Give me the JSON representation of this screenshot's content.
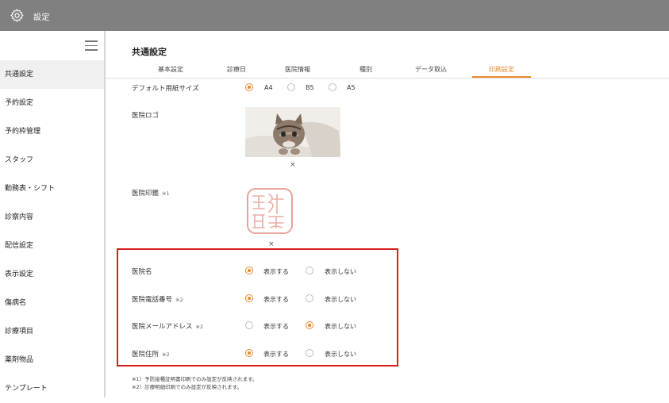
{
  "header": {
    "title": "設定",
    "icon": "gear-icon"
  },
  "sidebar": {
    "items": [
      {
        "label": "共通設定",
        "active": true
      },
      {
        "label": "予約設定"
      },
      {
        "label": "予約枠管理"
      },
      {
        "label": "スタッフ"
      },
      {
        "label": "勤務表・シフト"
      },
      {
        "label": "診察内容"
      },
      {
        "label": "配信設定"
      },
      {
        "label": "表示設定"
      },
      {
        "label": "傷病名"
      },
      {
        "label": "診療項目"
      },
      {
        "label": "薬剤物品"
      },
      {
        "label": "テンプレート"
      }
    ]
  },
  "main": {
    "title": "共通設定",
    "tabs": [
      {
        "label": "基本設定"
      },
      {
        "label": "診療日"
      },
      {
        "label": "医院情報"
      },
      {
        "label": "種別"
      },
      {
        "label": "データ取込"
      },
      {
        "label": "印刷設定",
        "active": true
      }
    ],
    "paper_size": {
      "label": "デフォルト用紙サイズ",
      "options": [
        "A4",
        "B5",
        "A5"
      ],
      "selected": "A4"
    },
    "logo": {
      "label": "医院ロゴ",
      "remove": "×"
    },
    "stamp": {
      "label": "医院印鑑",
      "note": "※1",
      "remove": "×"
    },
    "display_settings": [
      {
        "label": "医院名",
        "note": "",
        "show": "表示する",
        "hide": "表示しない",
        "selected": "show"
      },
      {
        "label": "医院電話番号",
        "note": "※2",
        "show": "表示する",
        "hide": "表示しない",
        "selected": "show"
      },
      {
        "label": "医院メールアドレス",
        "note": "※2",
        "show": "表示する",
        "hide": "表示しない",
        "selected": "hide"
      },
      {
        "label": "医院住所",
        "note": "※2",
        "show": "表示する",
        "hide": "表示しない",
        "selected": "show"
      }
    ],
    "footnotes": [
      "※1）予防接種証明書印刷でのみ設定が反映されます。",
      "※2）診療明細印刷でのみ設定が反映されます。"
    ]
  },
  "colors": {
    "accent": "#e88a2a",
    "highlight": "#d81e1e",
    "header_bg": "#808080"
  }
}
